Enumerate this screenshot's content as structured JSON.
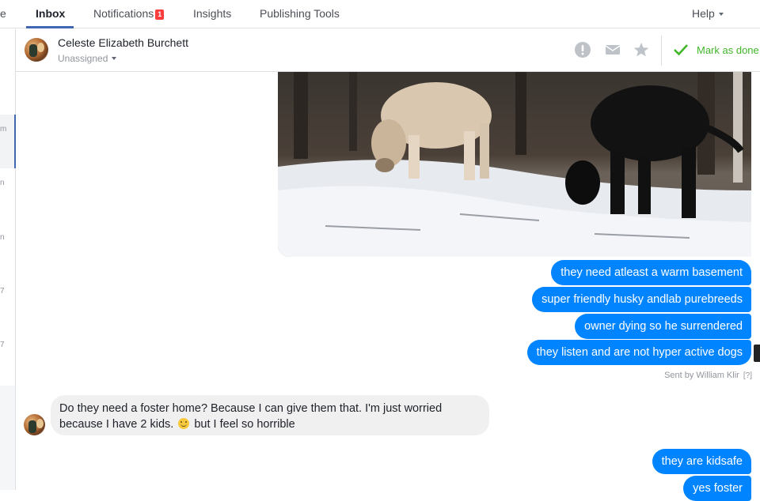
{
  "topnav": {
    "cut_item": "e",
    "inbox": "Inbox",
    "notifications": "Notifications",
    "notifications_badge": "1",
    "insights": "Insights",
    "publishing_tools": "Publishing Tools",
    "help": "Help"
  },
  "left_list": {
    "fragments": [
      "m",
      "n",
      "n",
      "7",
      "7"
    ]
  },
  "conversation": {
    "name": "Celeste Elizabeth Burchett",
    "assignment": "Unassigned",
    "mark_done": "Mark as done",
    "icons": [
      "alert-icon",
      "envelope-icon",
      "star-icon",
      "checkmark-icon"
    ]
  },
  "messages": {
    "photo_alt": "photo",
    "outgoing": [
      "they need atleast a warm basement",
      "super friendly husky andlab purebreeds",
      "owner dying so he surrendered",
      "they listen and are not hyper active dogs"
    ],
    "sent_by": "Sent by William Klir",
    "sent_by_help": "[?]",
    "incoming": {
      "line1": "Do they need a foster home? Because I can give them that. I'm just worried",
      "line2_before": "because I have 2 kids.",
      "line2_after": "but I feel so horrible"
    },
    "outgoing_2": [
      "they are kidsafe",
      "yes foster"
    ]
  },
  "colors": {
    "accent": "#4267b2",
    "bubble_out": "#0084ff",
    "bubble_in": "#f1f0f0",
    "done_green": "#42b72a",
    "badge_red": "#fa3e3e"
  }
}
